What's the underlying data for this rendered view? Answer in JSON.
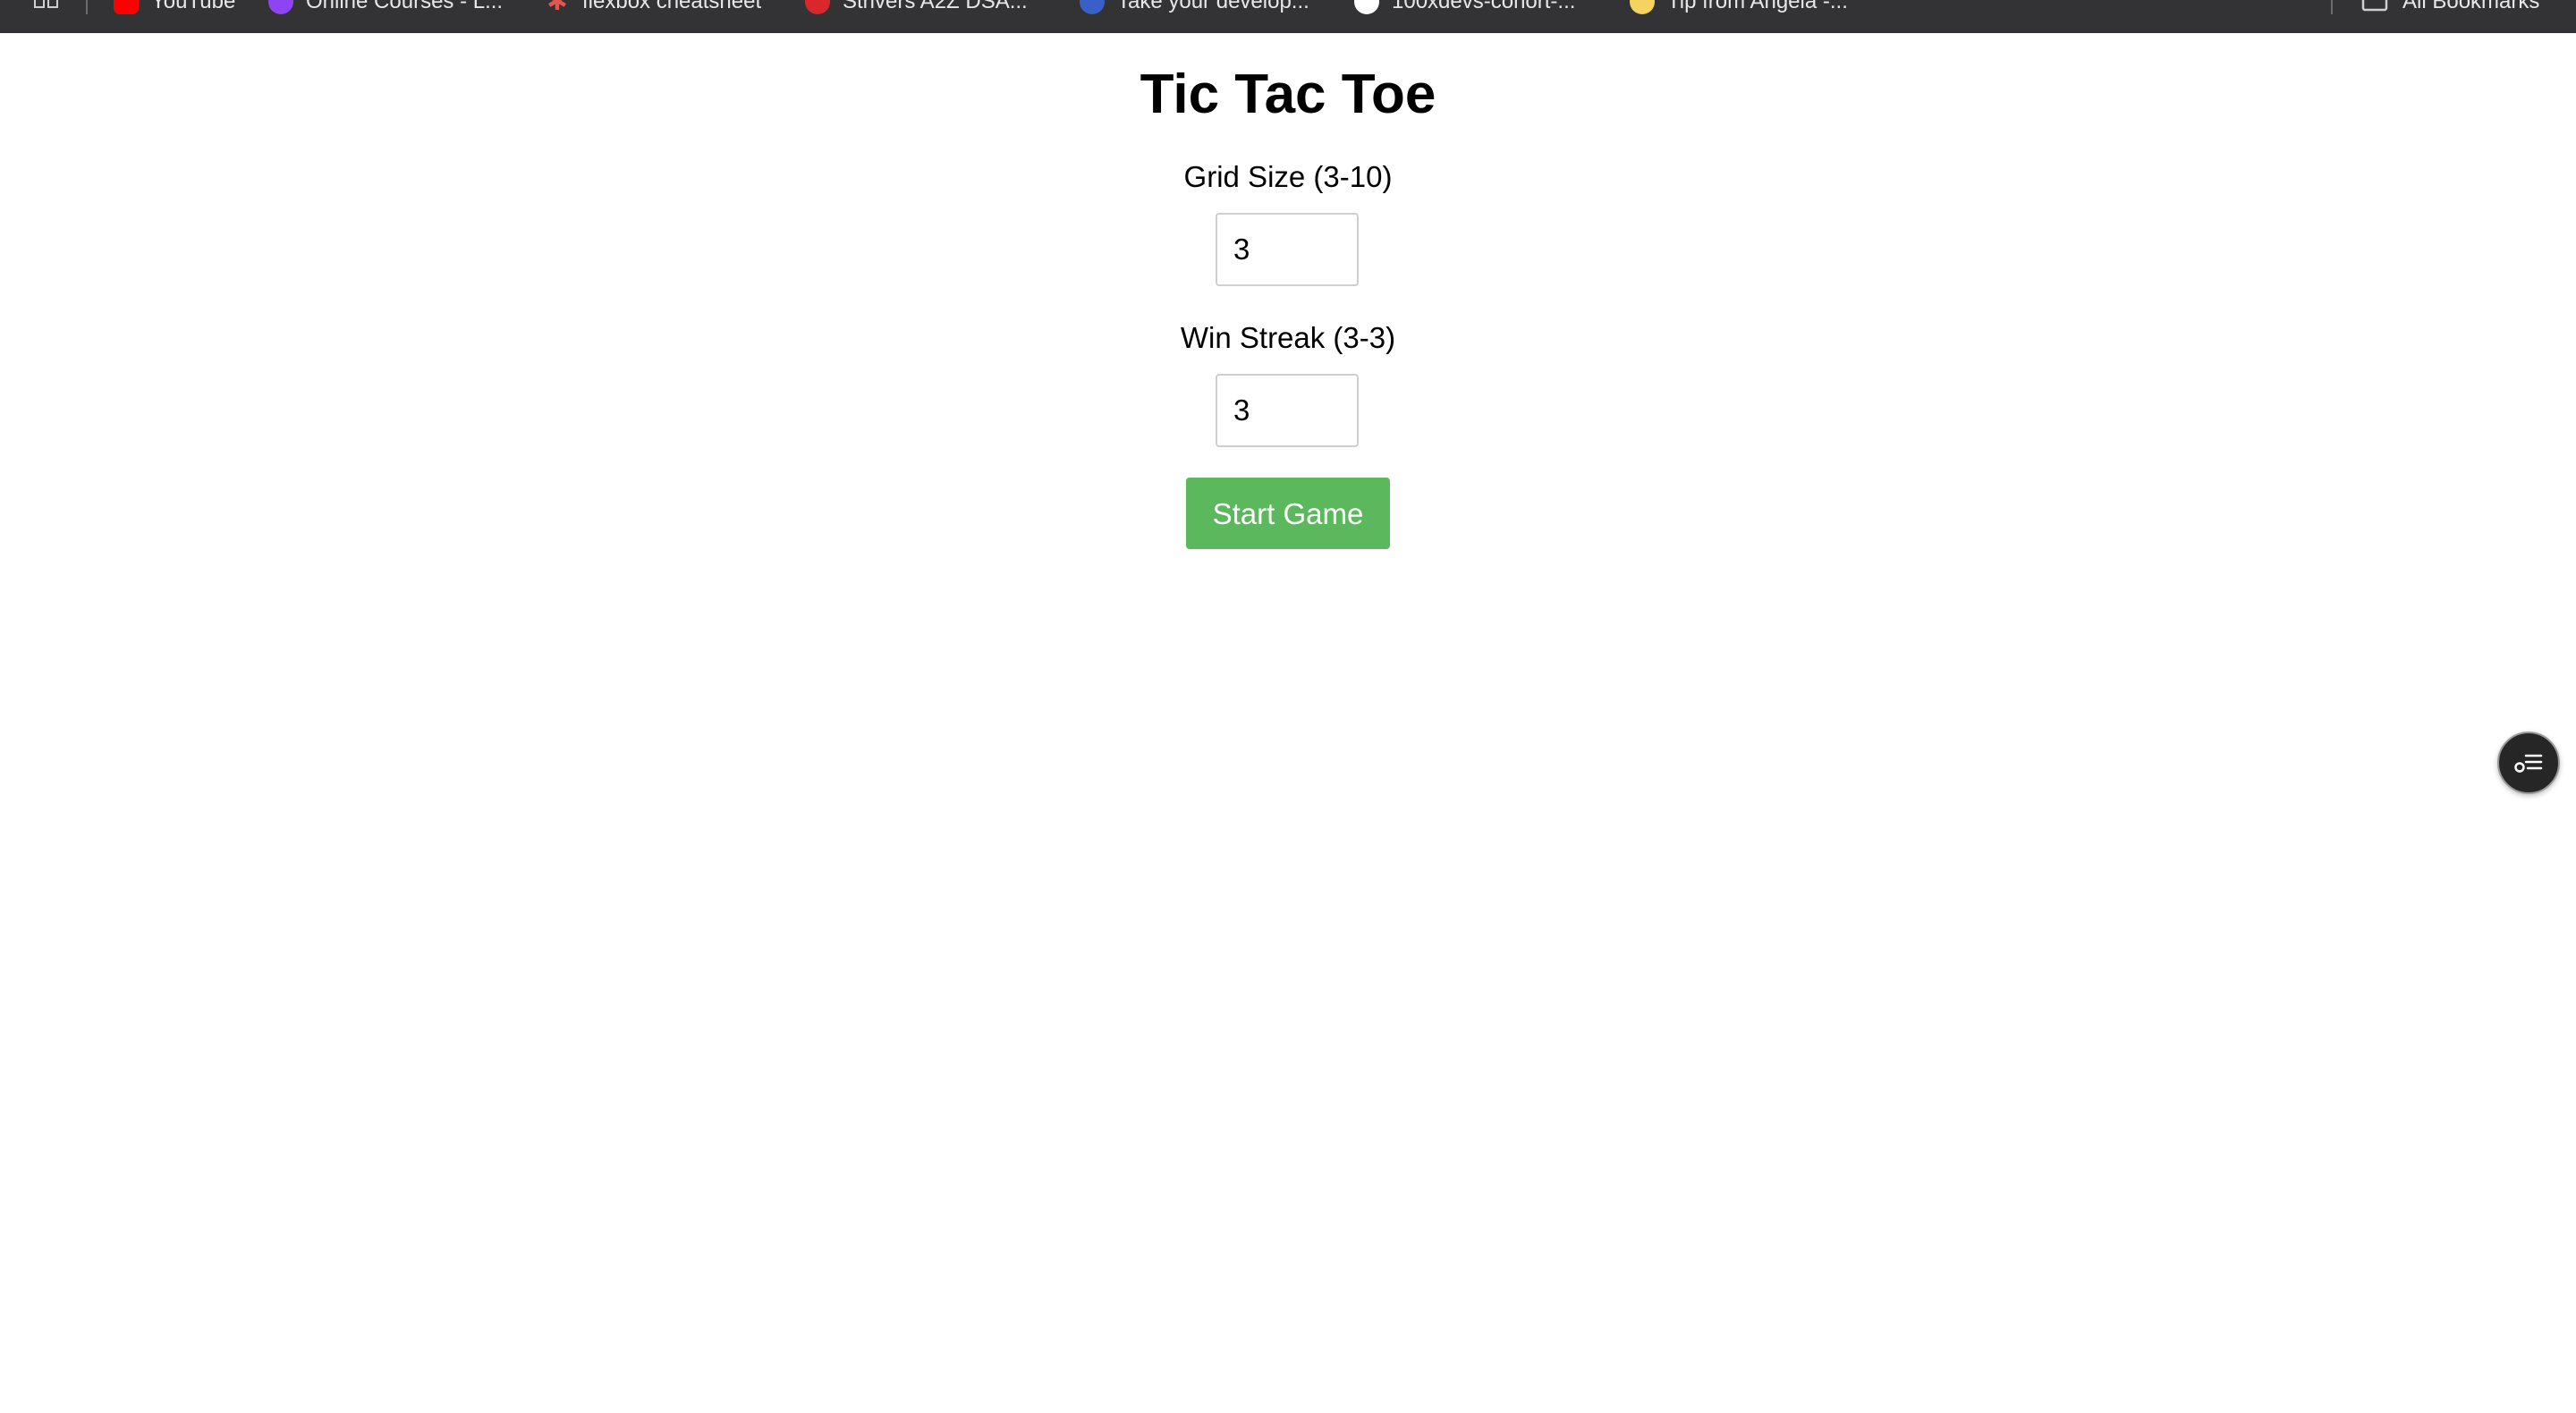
{
  "bookmarks": {
    "items": [
      {
        "label": "YouTube",
        "icon": "youtube-icon",
        "color": "#ff0000"
      },
      {
        "label": "Online Courses - L...",
        "icon": "udemy-icon",
        "color": "#8e44f0"
      },
      {
        "label": "flexbox cheatsheet",
        "icon": "flexbox-icon",
        "color": "#e2574c"
      },
      {
        "label": "Strivers A2Z DSA...",
        "icon": "tuf-icon",
        "color": "#d9282b"
      },
      {
        "label": "Take your develop...",
        "icon": "profile-icon",
        "color": "#3a5fc8"
      },
      {
        "label": "100xdevs-cohort-...",
        "icon": "github-icon",
        "color": "#ffffff"
      },
      {
        "label": "Tip from Angela -...",
        "icon": "angela-icon",
        "color": "#f4d35e"
      }
    ],
    "all_bookmarks_label": "All Bookmarks"
  },
  "game": {
    "title": "Tic Tac Toe",
    "grid_size_label": "Grid Size (3-10)",
    "grid_size_value": "3",
    "win_streak_label": "Win Streak (3-3)",
    "win_streak_value": "3",
    "start_button_label": "Start Game"
  },
  "colors": {
    "bookmarks_bar": "#333335",
    "start_button": "#5cb85c",
    "floating_button": "#262626"
  }
}
